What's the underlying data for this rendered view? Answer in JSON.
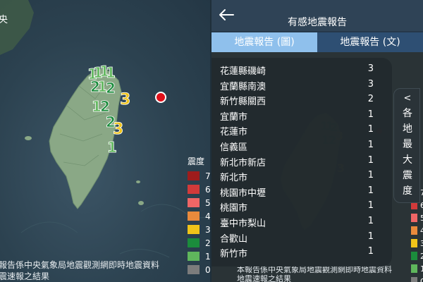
{
  "left": {
    "cut_title": "央",
    "legend_title": "震度",
    "notice_line1": "報告係中央氣象局地震觀測網即時地震資料",
    "notice_line2": "震速報之結果"
  },
  "intensity_legend": [
    {
      "level": "7",
      "color": "#9e1c1c"
    },
    {
      "level": "6",
      "color": "#d23a3a"
    },
    {
      "level": "5",
      "color": "#ef6666"
    },
    {
      "level": "4",
      "color": "#e98a3c"
    },
    {
      "level": "3",
      "color": "#f0c419"
    },
    {
      "level": "2",
      "color": "#1b8c3c"
    },
    {
      "level": "1",
      "color": "#5fb65c"
    },
    {
      "level": "0",
      "color": "#7c7c7c"
    }
  ],
  "header": {
    "title": "有感地震報告",
    "back_icon": "arrow-left-icon"
  },
  "tabs": [
    {
      "label": "地震報告 (圖)",
      "active": true
    },
    {
      "label": "地震報告 (文)",
      "active": false
    }
  ],
  "regions": [
    {
      "name": "花蓮縣磯崎",
      "value": "3"
    },
    {
      "name": "宜蘭縣南澳",
      "value": "3"
    },
    {
      "name": "新竹縣關西",
      "value": "2"
    },
    {
      "name": "宜蘭市",
      "value": "1"
    },
    {
      "name": "花蓮市",
      "value": "1"
    },
    {
      "name": "信義區",
      "value": "1"
    },
    {
      "name": "新北市新店",
      "value": "1"
    },
    {
      "name": "新北市",
      "value": "1"
    },
    {
      "name": "桃園市中壢",
      "value": "1"
    },
    {
      "name": "桃園市",
      "value": "1"
    },
    {
      "name": "臺中市梨山",
      "value": "1"
    },
    {
      "name": "合歡山",
      "value": "1"
    },
    {
      "name": "新竹市",
      "value": "1"
    }
  ],
  "side_tab": {
    "arrow": "<",
    "label": "各地最大震度"
  },
  "right_notice": {
    "line1": "本報告係中央氣象局地震觀測網即時地震資料",
    "line2": "地震速報之結果"
  },
  "map_markers": {
    "epicenter_color": "#e0101a",
    "left_numbers": [
      "1",
      "1",
      "1",
      "1",
      "2",
      "1",
      "2",
      "3",
      "1",
      "2",
      "2",
      "3",
      "1"
    ],
    "right_numbers": [
      "1",
      "1",
      "2",
      "1",
      "2",
      "3",
      "3"
    ]
  }
}
